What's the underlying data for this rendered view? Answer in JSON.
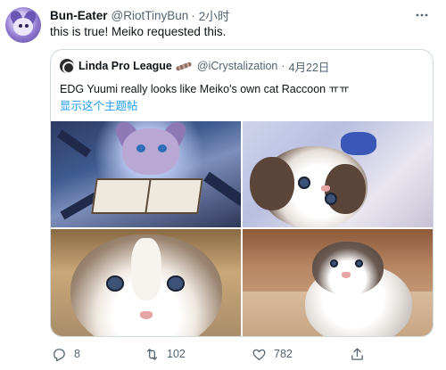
{
  "tweet": {
    "display_name": "Bun-Eater",
    "handle": "@RiotTinyBun",
    "separator": "·",
    "time": "2小时",
    "text": "this is true! Meiko requested this.",
    "more_icon": "more-horizontal-icon"
  },
  "quote": {
    "display_name": "Linda Pro League",
    "handle": "@iCrystalization",
    "separator": "·",
    "date": "4月22日",
    "text": "EDG Yuumi really looks like Meiko's own cat Raccoon ㅠㅠ",
    "show_thread": "显示这个主题帖",
    "emoji_icon": "baguette-emoji-icon",
    "photos": [
      {
        "name": "yuumi-artwork",
        "description_icon": "image"
      },
      {
        "name": "cat-photo-lace",
        "description_icon": "image"
      },
      {
        "name": "cat-photo-closeup",
        "description_icon": "image"
      },
      {
        "name": "cat-photo-floor",
        "description_icon": "image"
      }
    ]
  },
  "actions": {
    "reply_count": "8",
    "retweet_count": "102",
    "like_count": "782",
    "icons": [
      "reply-icon",
      "retweet-icon",
      "like-icon",
      "share-icon"
    ]
  },
  "colors": {
    "text_primary": "#0f1419",
    "text_secondary": "#536471",
    "link": "#1d9bf0",
    "border": "#cfd9de"
  }
}
